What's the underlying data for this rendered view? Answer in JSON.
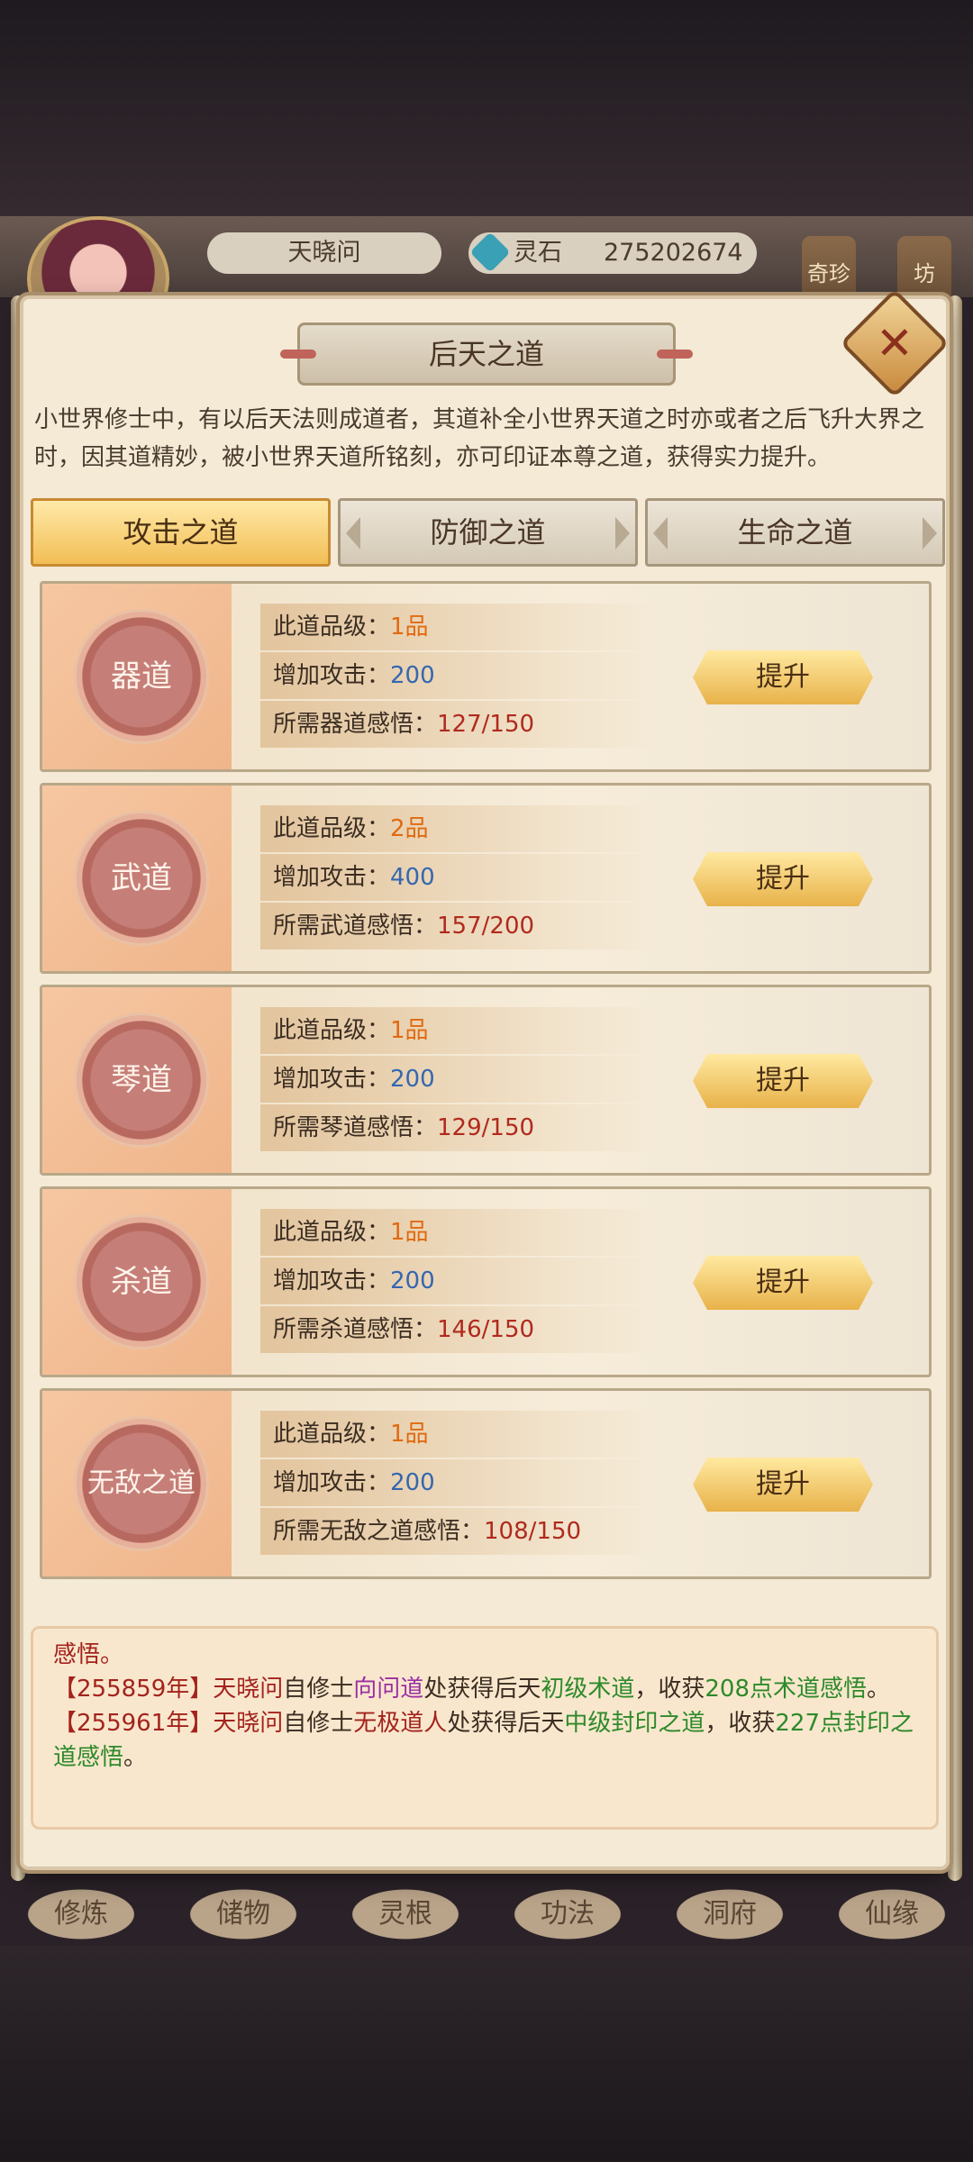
{
  "background": {
    "player_name": "天晓问",
    "resource_label": "灵石",
    "resource_value": "275202674",
    "side_buttons": [
      "奇珍",
      "坊"
    ],
    "bottom_nav": [
      "修炼",
      "储物",
      "灵根",
      "功法",
      "洞府",
      "仙缘"
    ]
  },
  "dialog": {
    "title": "后天之道",
    "intro": "小世界修士中，有以后天法则成道者，其道补全小世界天道之时亦或者之后飞升大界之时，因其道精妙，被小世界天道所铭刻，亦可印证本尊之道，获得实力提升。",
    "tabs": [
      "攻击之道",
      "防御之道",
      "生命之道"
    ],
    "active_tab": "攻击之道",
    "labels": {
      "grade": "此道品级：",
      "attack": "增加攻击：",
      "upgrade": "提升"
    },
    "cards": [
      {
        "name": "器道",
        "grade": "1品",
        "attack": "200",
        "req_label": "所需器道感悟：",
        "req": "127/150"
      },
      {
        "name": "武道",
        "grade": "2品",
        "attack": "400",
        "req_label": "所需武道感悟：",
        "req": "157/200"
      },
      {
        "name": "琴道",
        "grade": "1品",
        "attack": "200",
        "req_label": "所需琴道感悟：",
        "req": "129/150"
      },
      {
        "name": "杀道",
        "grade": "1品",
        "attack": "200",
        "req_label": "所需杀道感悟：",
        "req": "146/150"
      },
      {
        "name": "无敌之道",
        "grade": "1品",
        "attack": "200",
        "req_label": "所需无敌之道感悟：",
        "req": "108/150"
      }
    ],
    "log": {
      "line0": "感悟。",
      "e1_year": "【255859年】",
      "e1_player": "天晓问",
      "e1_t1": "自修士",
      "e1_npc": "向问道",
      "e1_t2": "处获得后天",
      "e1_item": "初级术道",
      "e1_t3": "，收获",
      "e1_amount": "208点术道感悟",
      "e1_t4": "。",
      "e2_year": "【255961年】",
      "e2_player": "天晓问",
      "e2_t1": "自修士",
      "e2_npc": "无极道人",
      "e2_t2": "处获得后天",
      "e2_item": "中级封印之道",
      "e2_t3": "，收获",
      "e2_amount": "227点封印之道感悟",
      "e2_t4": "。"
    }
  }
}
